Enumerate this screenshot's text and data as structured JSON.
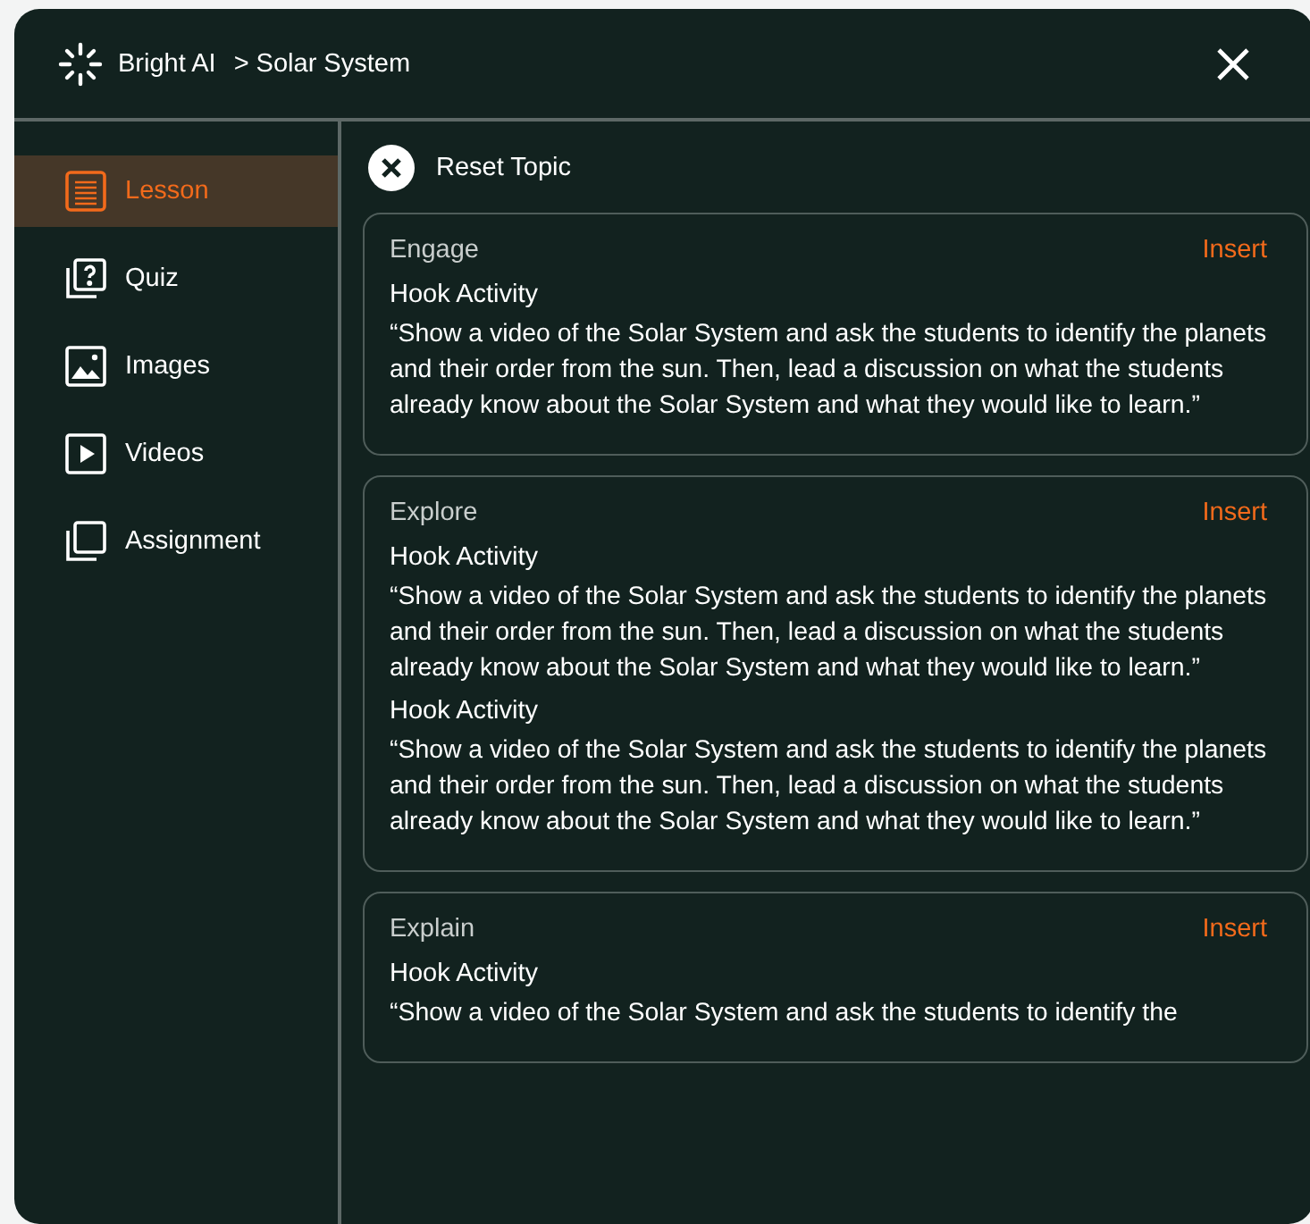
{
  "header": {
    "brand": "Bright AI",
    "breadcrumb": "> Solar System"
  },
  "sidebar": {
    "items": [
      {
        "label": "Lesson",
        "kind": "lesson",
        "selected": true
      },
      {
        "label": "Quiz",
        "kind": "quiz",
        "selected": false
      },
      {
        "label": "Images",
        "kind": "images",
        "selected": false
      },
      {
        "label": "Videos",
        "kind": "videos",
        "selected": false
      },
      {
        "label": "Assignment",
        "kind": "assignment",
        "selected": false
      }
    ]
  },
  "reset": {
    "label": "Reset Topic"
  },
  "cards": [
    {
      "title": "Engage",
      "action": "Insert",
      "activities": [
        {
          "heading": "Hook Activity",
          "text": "“Show a video of the Solar System and ask the students to identify the planets and their order from the sun. Then, lead a discussion on what the students already know about the Solar System and what they would like to learn.”"
        }
      ]
    },
    {
      "title": "Explore",
      "action": "Insert",
      "activities": [
        {
          "heading": "Hook Activity",
          "text": "“Show a video of the Solar System and ask the students to identify the planets and their order from the sun. Then, lead a discussion on what the students already know about the Solar System and what they would like to learn.”"
        },
        {
          "heading": "Hook Activity",
          "text": "“Show a video of the Solar System and ask the students to identify the planets and their order from the sun. Then, lead a discussion on what the students already know about the Solar System and what they would like to learn.”"
        }
      ]
    },
    {
      "title": "Explain",
      "action": "Insert",
      "activities": [
        {
          "heading": "Hook Activity",
          "text": "“Show a video of the Solar System and ask the students to identify the"
        }
      ]
    }
  ]
}
